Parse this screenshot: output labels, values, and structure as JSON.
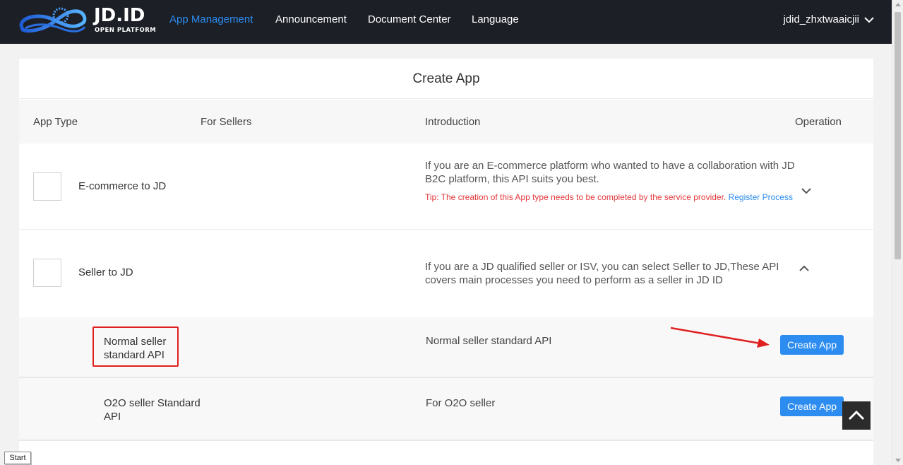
{
  "header": {
    "logo_text": "JD.ID",
    "logo_subtext": "OPEN PLATFORM",
    "nav": [
      {
        "label": "App Management",
        "active": true
      },
      {
        "label": "Announcement",
        "active": false
      },
      {
        "label": "Document Center",
        "active": false
      },
      {
        "label": "Language",
        "active": false
      }
    ],
    "username": "jdid_zhxtwaaicjii",
    "user_menu_icon": "chevron-down-icon"
  },
  "page": {
    "title": "Create App",
    "columns": {
      "app_type": "App Type",
      "for_sellers": "For Sellers",
      "introduction": "Introduction",
      "operation": "Operation"
    },
    "app_types": [
      {
        "label": "E-commerce to JD",
        "intro": "If you are an E-commerce platform who wanted to have a collaboration with JD B2C platform, this API suits you best.",
        "tip": "Tip: The creation of this App type needs to be completed by the service provider.",
        "tip_link": "Register Process",
        "expand_icon": "chevron-down-icon"
      },
      {
        "label": "Seller to JD",
        "intro": "If you are a JD qualified seller or ISV, you can select Seller to JD,These API covers main processes you need to perform as a seller in JD ID",
        "expand_icon": "chevron-up-icon",
        "sub_items": [
          {
            "label": "Normal seller standard API",
            "intro": "Normal seller standard API",
            "button": "Create App"
          },
          {
            "label": "O2O seller Standard API",
            "intro": "For O2O seller",
            "button": "Create App"
          }
        ]
      }
    ]
  },
  "colors": {
    "header_bg": "#1c1f26",
    "accent": "#2c8cf0",
    "tip_red": "#e4393c",
    "annotation_red": "#e02020"
  },
  "misc": {
    "back_to_top_icon": "chevron-up-icon",
    "start_label": "Start"
  }
}
